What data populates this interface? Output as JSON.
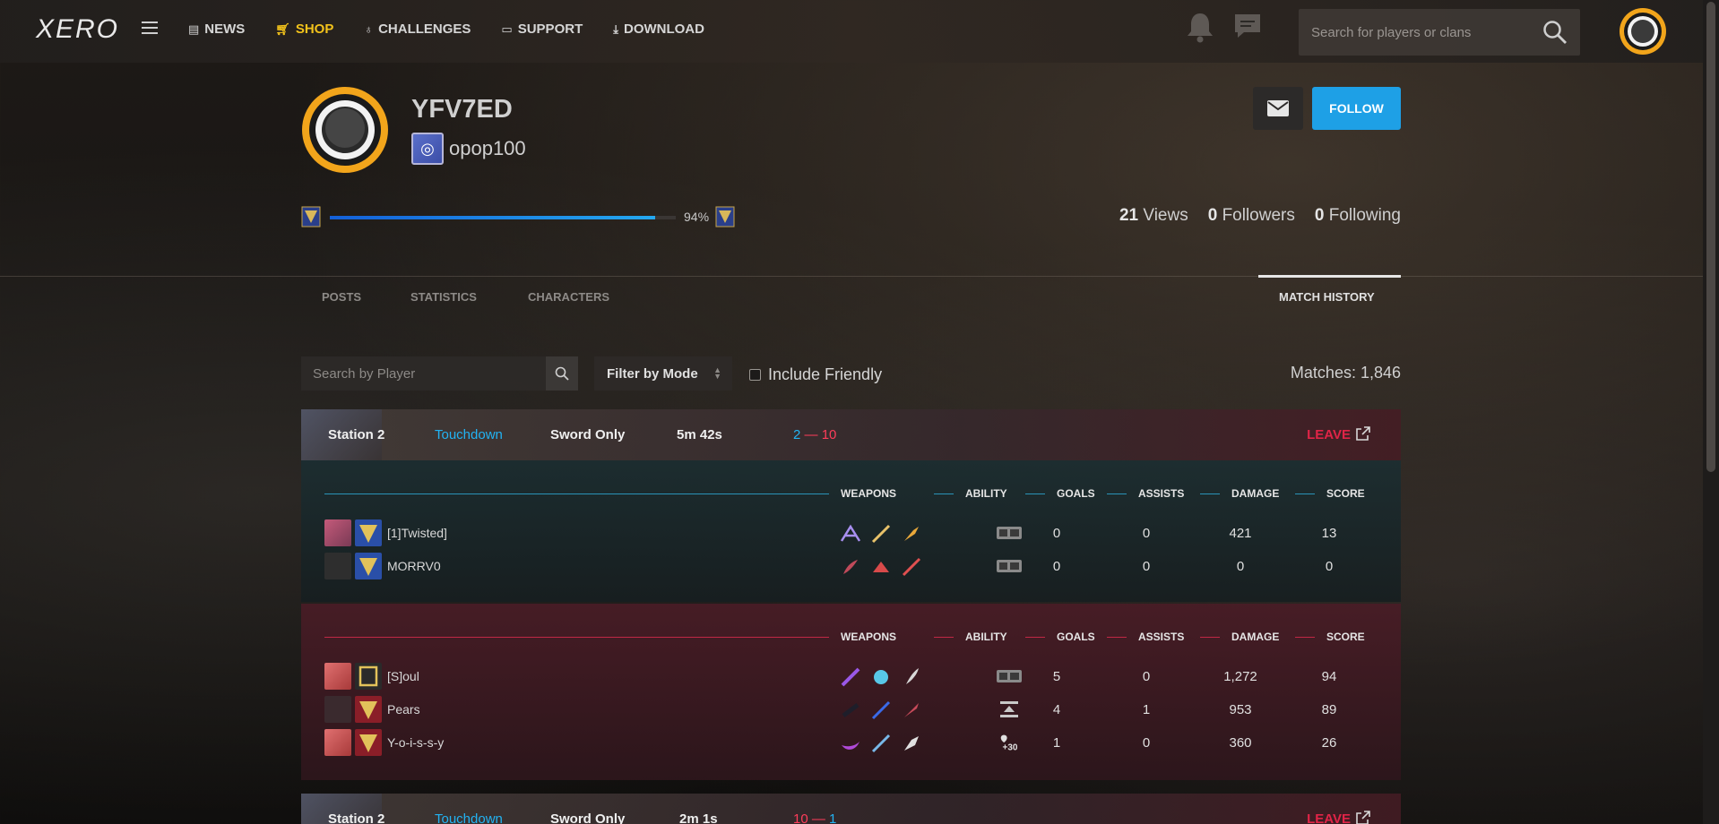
{
  "nav": {
    "logo": "XERO",
    "items": [
      {
        "label": "NEWS",
        "icon": "newspaper-icon"
      },
      {
        "label": "SHOP",
        "icon": "cart-icon"
      },
      {
        "label": "CHALLENGES",
        "icon": "challenge-icon"
      },
      {
        "label": "SUPPORT",
        "icon": "ticket-icon"
      },
      {
        "label": "DOWNLOAD",
        "icon": "download-icon"
      }
    ],
    "active_color": "#f2c21b",
    "search_placeholder": "Search for players or clans"
  },
  "profile": {
    "username": "YFV7ED",
    "clan": "opop100",
    "level_progress_pct": 94,
    "level_progress_label": "94%",
    "views": "21",
    "views_label": "Views",
    "followers": "0",
    "followers_label": "Followers",
    "following": "0",
    "following_label": "Following",
    "follow_label": "FOLLOW"
  },
  "tabs": [
    {
      "label": "POSTS"
    },
    {
      "label": "STATISTICS"
    },
    {
      "label": "CHARACTERS"
    },
    {
      "label": "MATCH HISTORY",
      "active": true
    }
  ],
  "filters": {
    "player_search_placeholder": "Search by Player",
    "mode_label": "Filter by Mode",
    "friendly_label": "Include Friendly",
    "matches_label": "Matches: 1,846"
  },
  "columns": {
    "weapons": "WEAPONS",
    "ability": "ABILITY",
    "goals": "GOALS",
    "assists": "ASSISTS",
    "damage": "DAMAGE",
    "score": "SCORE"
  },
  "match": {
    "map": "Station 2",
    "mode": "Touchdown",
    "rule": "Sword Only",
    "duration": "5m 42s",
    "score_a": "2",
    "score_sep": "—",
    "score_b": "10",
    "result": "LEAVE",
    "blue_team": [
      {
        "name": "[1]Twisted]",
        "goals": "0",
        "assists": "0",
        "damage": "421",
        "score": "13"
      },
      {
        "name": "MORRV0",
        "goals": "0",
        "assists": "0",
        "damage": "0",
        "score": "0"
      }
    ],
    "red_team": [
      {
        "name": "[S]oul",
        "goals": "5",
        "assists": "0",
        "damage": "1,272",
        "score": "94"
      },
      {
        "name": "Pears",
        "goals": "4",
        "assists": "1",
        "damage": "953",
        "score": "89"
      },
      {
        "name": "Y-o-i-s-s-y",
        "goals": "1",
        "assists": "0",
        "damage": "360",
        "score": "26"
      }
    ]
  },
  "next_match": {
    "map": "Station 2",
    "mode": "Touchdown",
    "rule": "Sword Only",
    "duration": "2m 1s",
    "score_a": "10",
    "score_sep": "—",
    "score_b": "1",
    "result": "LEAVE"
  }
}
